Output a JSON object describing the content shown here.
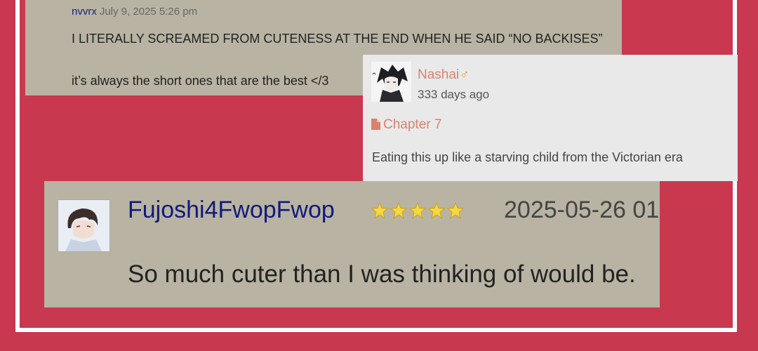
{
  "comment1": {
    "author": "nvvrx",
    "date": "July 9, 2025 5:26 pm",
    "line1": "I LITERALLY SCREAMED FROM CUTENESS AT THE END WHEN HE SAID “NO BACKISES”",
    "line2": "it’s always the short ones that are the best </3"
  },
  "comment2": {
    "username": "Nashai",
    "gender_symbol": "♂",
    "time_ago": "333 days ago",
    "chapter": "Chapter 7",
    "text": "Eating this up like a starving child from the Victorian era",
    "icon": "file-icon"
  },
  "comment3": {
    "username": "Fujoshi4FwopFwop",
    "rating": 5,
    "timestamp": "2025-05-26 01",
    "text": "So much cuter than I was thinking of would be."
  },
  "colors": {
    "background": "#c8384f",
    "card_tan": "#b8b3a3",
    "card_gray": "#e9e9e9",
    "username_orange": "#d9826d",
    "username_navy": "#101a7a",
    "star": "#f5d742"
  }
}
